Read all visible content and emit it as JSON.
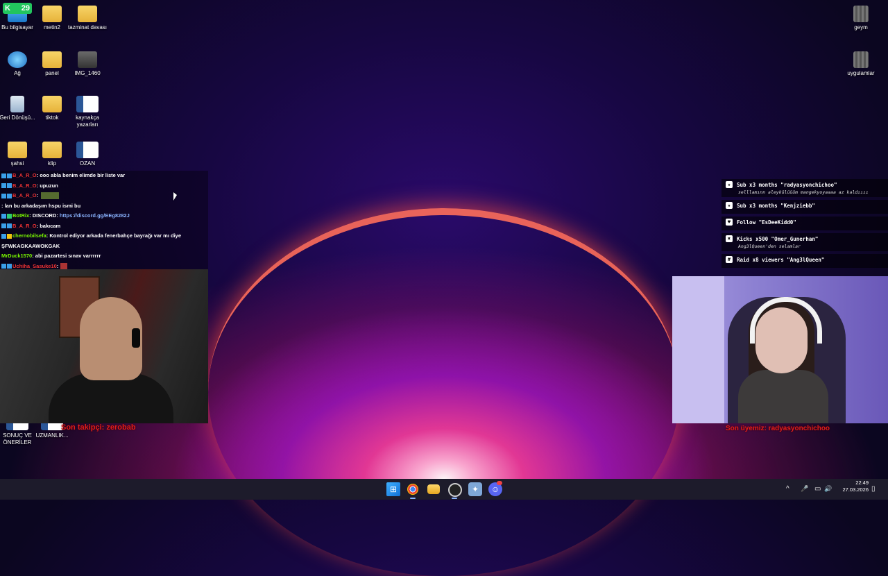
{
  "desktop": {
    "icons": [
      {
        "label": "Bu bilgisayar"
      },
      {
        "label": "metin2"
      },
      {
        "label": "tazminat davası"
      },
      {
        "label": "Ağ"
      },
      {
        "label": "panel"
      },
      {
        "label": "IMG_1460"
      },
      {
        "label": "Geri Dönüşü..."
      },
      {
        "label": "tiktok"
      },
      {
        "label": "kaynakça yazarları"
      },
      {
        "label": "şahsi"
      },
      {
        "label": "klip"
      },
      {
        "label": "OZAN"
      },
      {
        "label": "geym"
      },
      {
        "label": "uygulamlar"
      },
      {
        "label": "SONUÇ VE ÖNERİLER"
      },
      {
        "label": "UZMANLIK..."
      }
    ],
    "corner_badge": "29"
  },
  "chat": {
    "messages": [
      {
        "user": "B_A_R_O",
        "text": ": ooo abla benim elimde bir liste var"
      },
      {
        "user": "B_A_R_O",
        "text": ": upuzun"
      },
      {
        "user": "B_A_R_O",
        "text": ":"
      },
      {
        "user": "",
        "text": ": lan bu arkadaşım hspu ismi bu"
      },
      {
        "user": "BotRix",
        "text": ": DISCORD: ",
        "link": "https://discord.gg/EEg8282J"
      },
      {
        "user": "B_A_R_O",
        "text": ": bakıcam"
      },
      {
        "user": "chernobilsefa",
        "text": ": Kontrol ediyor arkada fenerbahçe bayrağı var mı diye"
      },
      {
        "user": "",
        "text": "ŞFWKAGKAAWOKGAK"
      },
      {
        "user": "MrDuck1570",
        "text": ": abi pazartesi sınav varrrrrr"
      },
      {
        "user": "Uchiha_Sasuke10",
        "text": ":"
      }
    ]
  },
  "overlays": {
    "last_follower": "Son takipçi: zerobab",
    "right_caption": "Son üyemiz: radyasyonchichoo"
  },
  "events": [
    {
      "icon": "star-icon",
      "title": "Sub x3 months \"radyasyonchichoo\"",
      "sub": "selllamınn aleykülüüüm mangekyoyaaaa az kaldıııı"
    },
    {
      "icon": "star-icon",
      "title": "Sub x3 months \"Kenjziebb\"",
      "sub": ""
    },
    {
      "icon": "heart-icon",
      "title": "Follow \"EsDeeKidd0\"",
      "sub": ""
    },
    {
      "icon": "kick-icon",
      "title": "Kicks x500 \"Omer_Gunerhan\"",
      "sub": "Ang3lQueen'den selamlar"
    },
    {
      "icon": "raid-icon",
      "title": "Raid x8 viewers \"Ang3lQueen\"",
      "sub": ""
    }
  ],
  "taskbar": {
    "apps": [
      {
        "name": "start-icon",
        "glyph": "⊞"
      },
      {
        "name": "chrome-icon",
        "glyph": ""
      },
      {
        "name": "file-explorer-icon",
        "glyph": ""
      },
      {
        "name": "obs-icon",
        "glyph": ""
      },
      {
        "name": "app-icon",
        "glyph": "✦"
      },
      {
        "name": "discord-icon",
        "glyph": "☺"
      }
    ],
    "tray": {
      "chevron": "^",
      "mic": "🎤",
      "network": "▭",
      "speaker": "🔊",
      "battery": "▯"
    },
    "time": "22:49",
    "date": "27.03.2026"
  }
}
